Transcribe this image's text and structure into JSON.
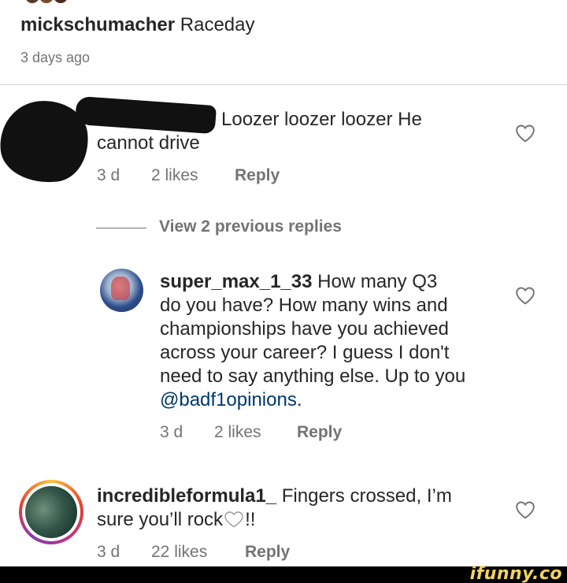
{
  "caption": {
    "username": "mickschumacher",
    "text": "Raceday",
    "time": "3 days ago"
  },
  "comments": [
    {
      "text_line1": "Loozer loozer loozer He",
      "text_line2": "cannot drive",
      "time": "3 d",
      "likes": "2 likes",
      "reply_label": "Reply"
    },
    {
      "username": "super_max_1_33",
      "text_line1": "How many Q3",
      "text_line2": "do you have? How many wins and",
      "text_line3": "championships have you achieved",
      "text_line4": "across your career? I guess I don't",
      "text_line5": "need to say anything else. Up to you",
      "mention": "@badf1opinions",
      "mention_suffix": ".",
      "time": "3 d",
      "likes": "2 likes",
      "reply_label": "Reply"
    },
    {
      "username": "incredibleformula1_",
      "text_line1": "Fingers crossed, I’m",
      "text_line2_before": "sure you’ll rock",
      "text_line2_after": "!!",
      "time": "3 d",
      "likes": "22 likes",
      "reply_label": "Reply"
    }
  ],
  "view_replies": "View 2 previous replies",
  "icons": {
    "heart": "heart-outline-icon",
    "white_heart": "white-heart-emoji"
  },
  "colors": {
    "text": "#262626",
    "secondary": "#737373",
    "mention": "#00376b",
    "watermark": "#f4d35e"
  },
  "watermark": "ifunny.co"
}
